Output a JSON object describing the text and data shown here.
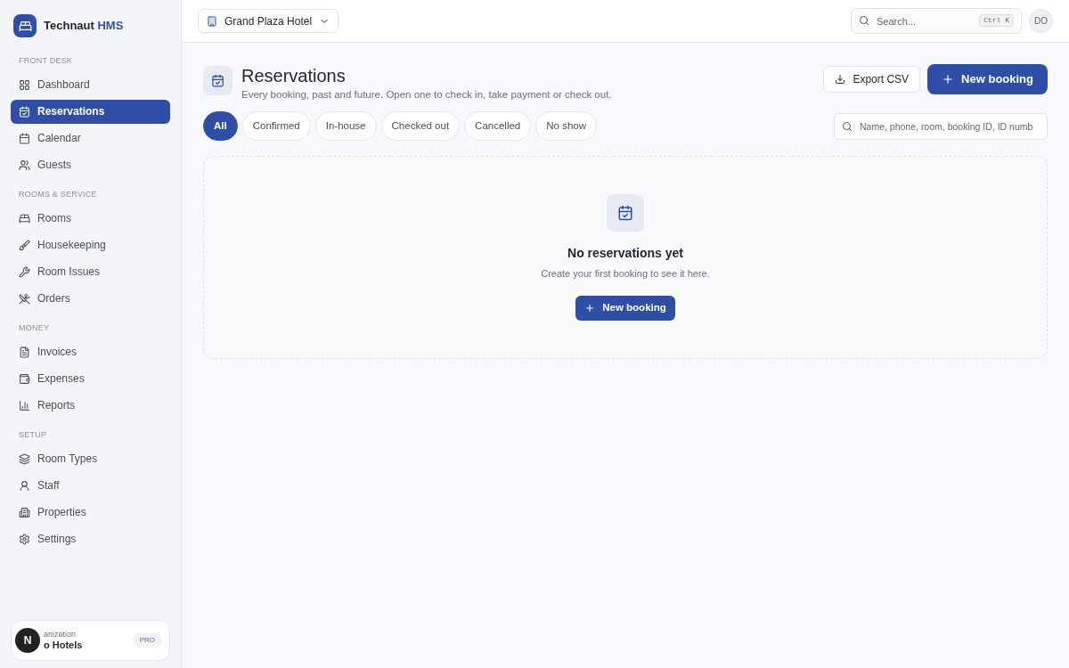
{
  "brand": {
    "name": "Technaut",
    "suffix": "HMS"
  },
  "sidebar": {
    "sections": [
      {
        "title": "FRONT DESK",
        "items": [
          {
            "label": "Dashboard",
            "selected": false
          },
          {
            "label": "Reservations",
            "selected": true
          },
          {
            "label": "Calendar",
            "selected": false
          },
          {
            "label": "Guests",
            "selected": false
          }
        ]
      },
      {
        "title": "ROOMS & SERVICE",
        "items": [
          {
            "label": "Rooms",
            "selected": false
          },
          {
            "label": "Housekeeping",
            "selected": false
          },
          {
            "label": "Room Issues",
            "selected": false
          },
          {
            "label": "Orders",
            "selected": false
          }
        ]
      },
      {
        "title": "MONEY",
        "items": [
          {
            "label": "Invoices",
            "selected": false
          },
          {
            "label": "Expenses",
            "selected": false
          },
          {
            "label": "Reports",
            "selected": false
          }
        ]
      },
      {
        "title": "SETUP",
        "items": [
          {
            "label": "Room Types",
            "selected": false
          },
          {
            "label": "Staff",
            "selected": false
          },
          {
            "label": "Properties",
            "selected": false
          },
          {
            "label": "Settings",
            "selected": false
          }
        ]
      }
    ],
    "organization": {
      "label": "anization",
      "name": "o Hotels",
      "plan": "PRO",
      "badge": "N"
    }
  },
  "topbar": {
    "property": "Grand Plaza Hotel",
    "search": {
      "placeholder": "Search...",
      "shortcut": "Ctrl K"
    },
    "avatar": "DO"
  },
  "page": {
    "title": "Reservations",
    "subtitle": "Every booking, past and future. Open one to check in, take payment or check out.",
    "actions": {
      "export": "Export CSV",
      "new": "New booking"
    }
  },
  "filters": [
    {
      "label": "All",
      "selected": true
    },
    {
      "label": "Confirmed",
      "selected": false
    },
    {
      "label": "In-house",
      "selected": false
    },
    {
      "label": "Checked out",
      "selected": false
    },
    {
      "label": "Cancelled",
      "selected": false
    },
    {
      "label": "No show",
      "selected": false
    }
  ],
  "table_search": {
    "placeholder": "Name, phone, room, booking ID, ID numb"
  },
  "empty_state": {
    "title": "No reservations yet",
    "text": "Create your first booking to see it here.",
    "button": "New booking"
  }
}
